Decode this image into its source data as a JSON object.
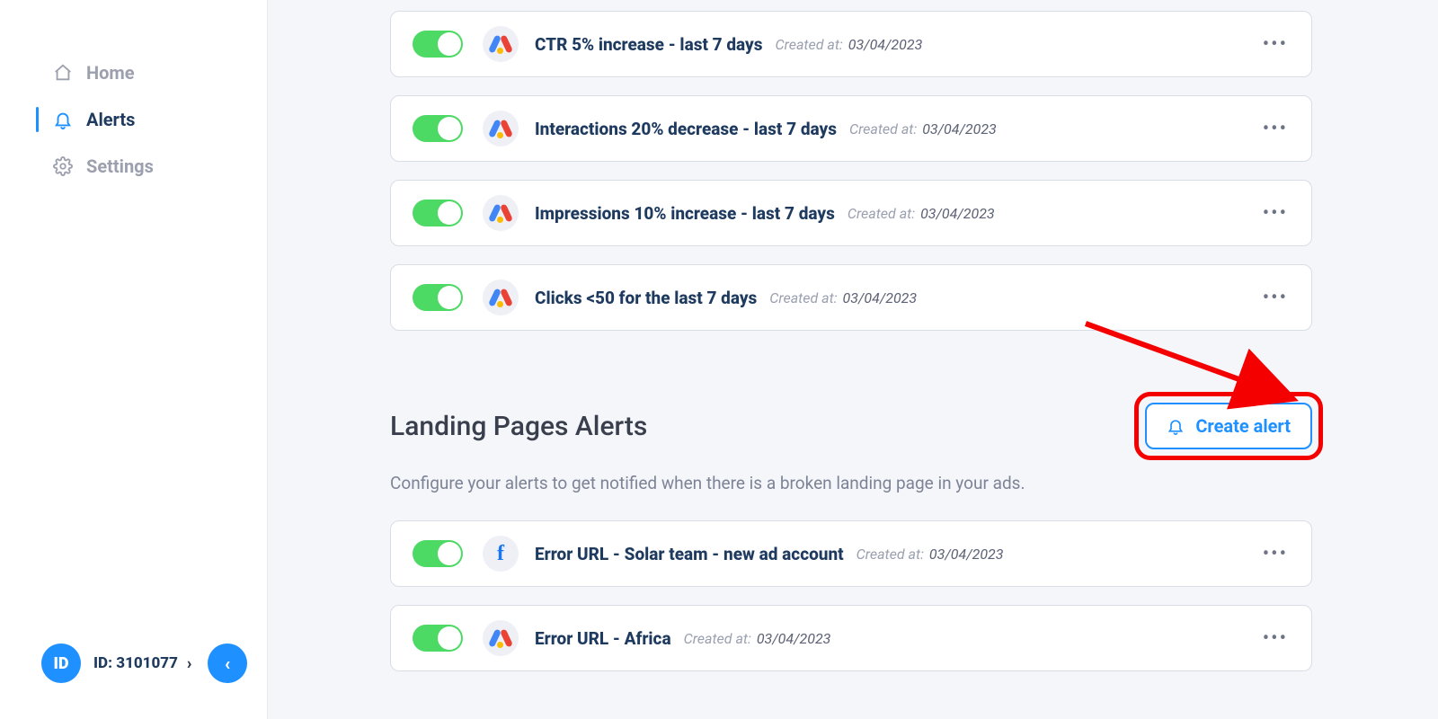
{
  "sidebar": {
    "items": [
      {
        "label": "Home"
      },
      {
        "label": "Alerts"
      },
      {
        "label": "Settings"
      }
    ],
    "id_badge": "ID",
    "id_label": "ID: 3101077"
  },
  "alerts_top": [
    {
      "title": "CTR 5% increase - last 7 days",
      "created_label": "Created at:",
      "date": "03/04/2023",
      "network": "google"
    },
    {
      "title": "Interactions 20% decrease - last 7 days",
      "created_label": "Created at:",
      "date": "03/04/2023",
      "network": "google"
    },
    {
      "title": "Impressions 10% increase - last 7 days",
      "created_label": "Created at:",
      "date": "03/04/2023",
      "network": "google"
    },
    {
      "title": "Clicks <50 for the last 7 days",
      "created_label": "Created at:",
      "date": "03/04/2023",
      "network": "google"
    }
  ],
  "landing_section": {
    "title": "Landing Pages Alerts",
    "desc": "Configure your alerts to get notified when there is a broken landing page in your ads.",
    "create_label": "Create alert",
    "alerts": [
      {
        "title": "Error URL - Solar team - new ad account",
        "created_label": "Created at:",
        "date": "03/04/2023",
        "network": "facebook"
      },
      {
        "title": "Error URL - Africa",
        "created_label": "Created at:",
        "date": "03/04/2023",
        "network": "google"
      }
    ]
  }
}
